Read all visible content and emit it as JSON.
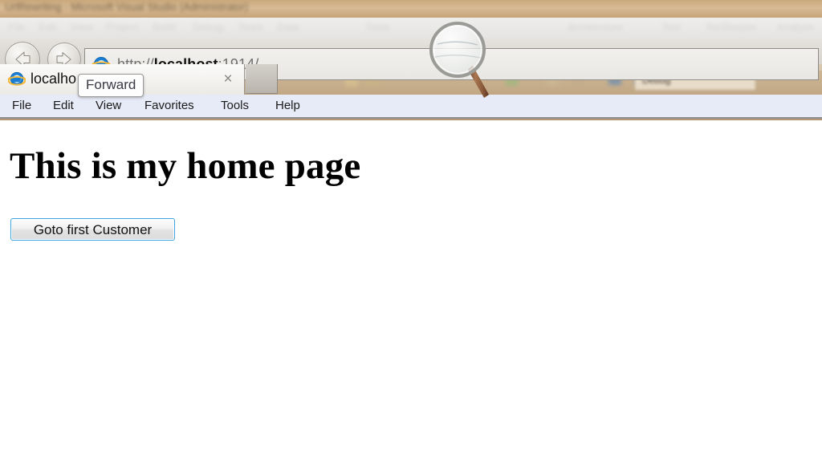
{
  "background_app": {
    "title": "UrlRewriting - Microsoft Visual Studio (Administrator)",
    "menu_items": [
      "File",
      "Edit",
      "View",
      "Project",
      "Build",
      "Debug",
      "Team",
      "Data",
      "Tools",
      "Architecture",
      "Test",
      "ReSharper",
      "Analyze"
    ],
    "config_selector": "Debug"
  },
  "browser": {
    "back_label": "Back",
    "forward_label": "Forward",
    "address_bar": {
      "protocol": "http://",
      "host": "localhost",
      "port_path": ":1914/",
      "full_url": "http://localhost:1914/"
    },
    "tab": {
      "label": "localho",
      "close_label": "×",
      "icon": "internet-explorer-icon"
    },
    "new_tab_label": "",
    "tooltip": "Forward",
    "menu": [
      "File",
      "Edit",
      "View",
      "Favorites",
      "Tools",
      "Help"
    ]
  },
  "page": {
    "heading": "This is my home page",
    "button_label": "Goto first Customer"
  },
  "colors": {
    "menubar_bg": "#e7ebf7",
    "button_border": "#3fa3dd",
    "address_text": "#6f6f6f",
    "address_host": "#121212"
  }
}
